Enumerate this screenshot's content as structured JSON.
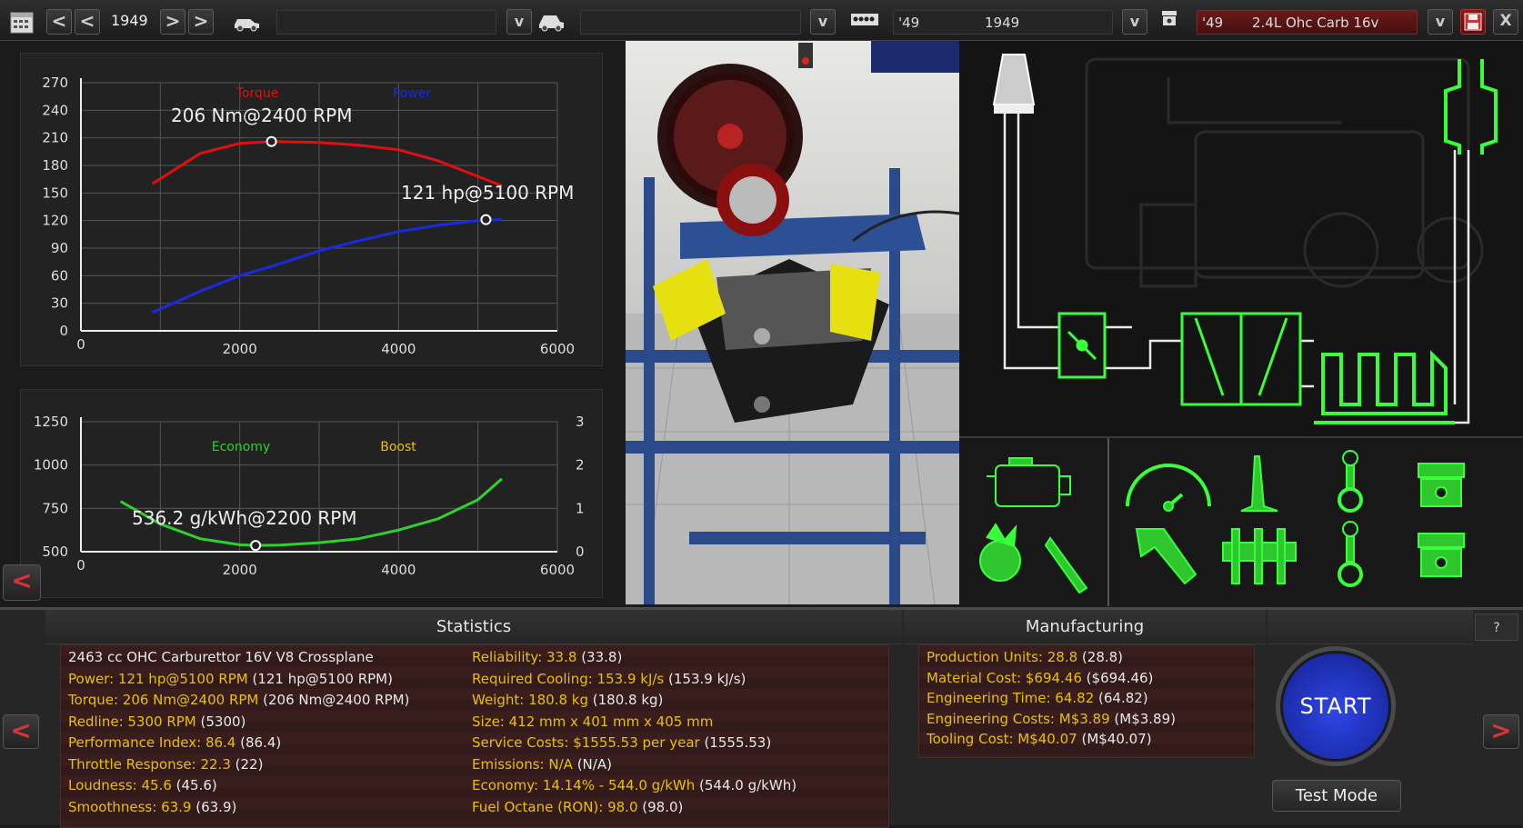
{
  "topbar": {
    "year": "1949",
    "family_year": "'49",
    "family_name": "1949",
    "variant_year": "'49",
    "variant_name": "2.4L Ohc Carb 16v",
    "prev_label": "<",
    "next_label": ">",
    "dropdown_label": "v",
    "close_label": "X"
  },
  "torque_chart": {
    "legend_torque": "Torque",
    "legend_power": "Power",
    "torque_annotation": "206 Nm@2400 RPM",
    "power_annotation": "121 hp@5100 RPM"
  },
  "economy_chart": {
    "legend_economy": "Economy",
    "legend_boost": "Boost",
    "economy_annotation": "536.2 g/kWh@2200 RPM"
  },
  "chart_data": [
    {
      "type": "line",
      "x": [
        900,
        1500,
        2000,
        2400,
        3000,
        3500,
        4000,
        4500,
        5000,
        5300
      ],
      "series": [
        {
          "name": "Torque",
          "color": "#e01010",
          "values": [
            160,
            193,
            204,
            206,
            205,
            202,
            197,
            185,
            168,
            158
          ]
        },
        {
          "name": "Power",
          "color": "#1a2ae0",
          "values": [
            20,
            43,
            60,
            70,
            87,
            98,
            108,
            115,
            120,
            121
          ]
        }
      ],
      "ylim": [
        0,
        270
      ],
      "xlim": [
        0,
        6000
      ],
      "yticks": [
        "0",
        "30",
        "60",
        "90",
        "120",
        "150",
        "180",
        "210",
        "240",
        "270"
      ],
      "xticks": [
        "0",
        "2000",
        "4000",
        "6000"
      ],
      "grid": true,
      "legend": "top"
    },
    {
      "type": "line",
      "x": [
        500,
        1000,
        1500,
        2000,
        2200,
        2500,
        3000,
        3500,
        4000,
        4500,
        5000,
        5300
      ],
      "series": [
        {
          "name": "Economy",
          "color": "#30d030",
          "values": [
            790,
            660,
            575,
            540,
            536,
            538,
            552,
            575,
            625,
            690,
            800,
            920
          ]
        }
      ],
      "ylim": [
        500,
        1250
      ],
      "y2lim": [
        0,
        3
      ],
      "xlim": [
        0,
        6000
      ],
      "yticks": [
        "500",
        "750",
        "1000",
        "1250"
      ],
      "y2ticks": [
        "0",
        "1",
        "2",
        "3"
      ],
      "xticks": [
        "0",
        "2000",
        "4000",
        "6000"
      ],
      "grid": true,
      "legend": "top"
    }
  ],
  "statistics": {
    "title": "Statistics",
    "left": [
      {
        "label": "",
        "value": "2463 cc OHC Carburettor 16V V8 Crossplane"
      },
      {
        "label": "Power: 121 hp@5100 RPM",
        "value": " (121 hp@5100 RPM)"
      },
      {
        "label": "Torque: 206 Nm@2400 RPM",
        "value": " (206 Nm@2400 RPM)"
      },
      {
        "label": "Redline: 5300 RPM",
        "value": " (5300)"
      },
      {
        "label": "Performance Index: 86.4",
        "value": " (86.4)"
      },
      {
        "label": "Throttle Response: 22.3",
        "value": " (22)"
      },
      {
        "label": "Loudness: 45.6",
        "value": " (45.6)"
      },
      {
        "label": "Smoothness: 63.9",
        "value": " (63.9)"
      }
    ],
    "right": [
      {
        "label": "Reliability: 33.8",
        "value": " (33.8)"
      },
      {
        "label": "Required Cooling: 153.9 kJ/s",
        "value": " (153.9 kJ/s)"
      },
      {
        "label": "Weight: 180.8 kg",
        "value": " (180.8 kg)"
      },
      {
        "label": "Size: 412 mm x 401 mm x 405 mm",
        "value": ""
      },
      {
        "label": "Service Costs: $1555.53 per year",
        "value": " (1555.53)"
      },
      {
        "label": "Emissions: N/A",
        "value": " (N/A)"
      },
      {
        "label": "Economy: 14.14% - 544.0 g/kWh",
        "value": " (544.0 g/kWh)"
      },
      {
        "label": "Fuel Octane (RON): 98.0",
        "value": " (98.0)"
      }
    ]
  },
  "manufacturing": {
    "title": "Manufacturing",
    "lines": [
      {
        "label": "Production Units: 28.8",
        "value": " (28.8)"
      },
      {
        "label": "Material Cost: $694.46",
        "value": " ($694.46)"
      },
      {
        "label": "Engineering Time: 64.82",
        "value": " (64.82)"
      },
      {
        "label": "Engineering Costs: M$3.89",
        "value": " (M$3.89)"
      },
      {
        "label": "Tooling Cost: M$40.07",
        "value": " (M$40.07)"
      }
    ]
  },
  "controls": {
    "start_label": "START",
    "test_mode_label": "Test Mode",
    "help_label": "?",
    "left_arrow": "<",
    "right_arrow": ">"
  },
  "colors": {
    "accent_yellow": "#e8c000",
    "neon_green": "#39ff3a",
    "start_blue": "#2340d8"
  }
}
